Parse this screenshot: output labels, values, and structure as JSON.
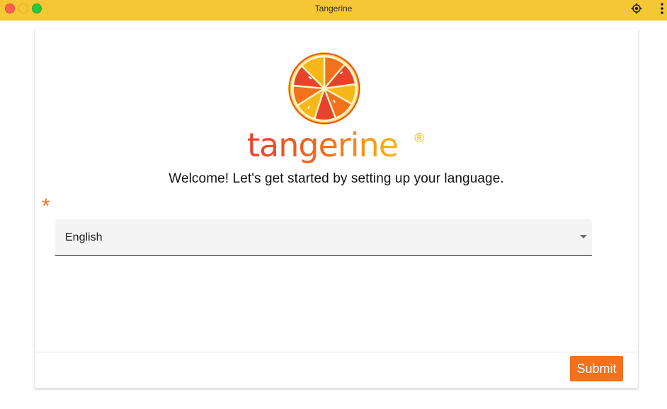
{
  "window": {
    "title": "Tangerine",
    "controls": [
      "close",
      "minimize",
      "maximize"
    ],
    "toolbar_icons": [
      "locate-icon",
      "more-vert-icon"
    ]
  },
  "logo": {
    "wordmark": "tangerine",
    "registered": "®",
    "colors": {
      "orange": "#f2711c",
      "yellow": "#f7b719",
      "red": "#e8422c",
      "ring": "#f7c93b"
    }
  },
  "welcome_text": "Welcome! Let's get started by setting up your language.",
  "language_field": {
    "required_marker": "*",
    "selected_value": "English"
  },
  "footer": {
    "submit_label": "Submit"
  },
  "colors": {
    "titlebar": "#f6c735",
    "accent": "#f2711c",
    "field_background": "#f4f4f4"
  }
}
